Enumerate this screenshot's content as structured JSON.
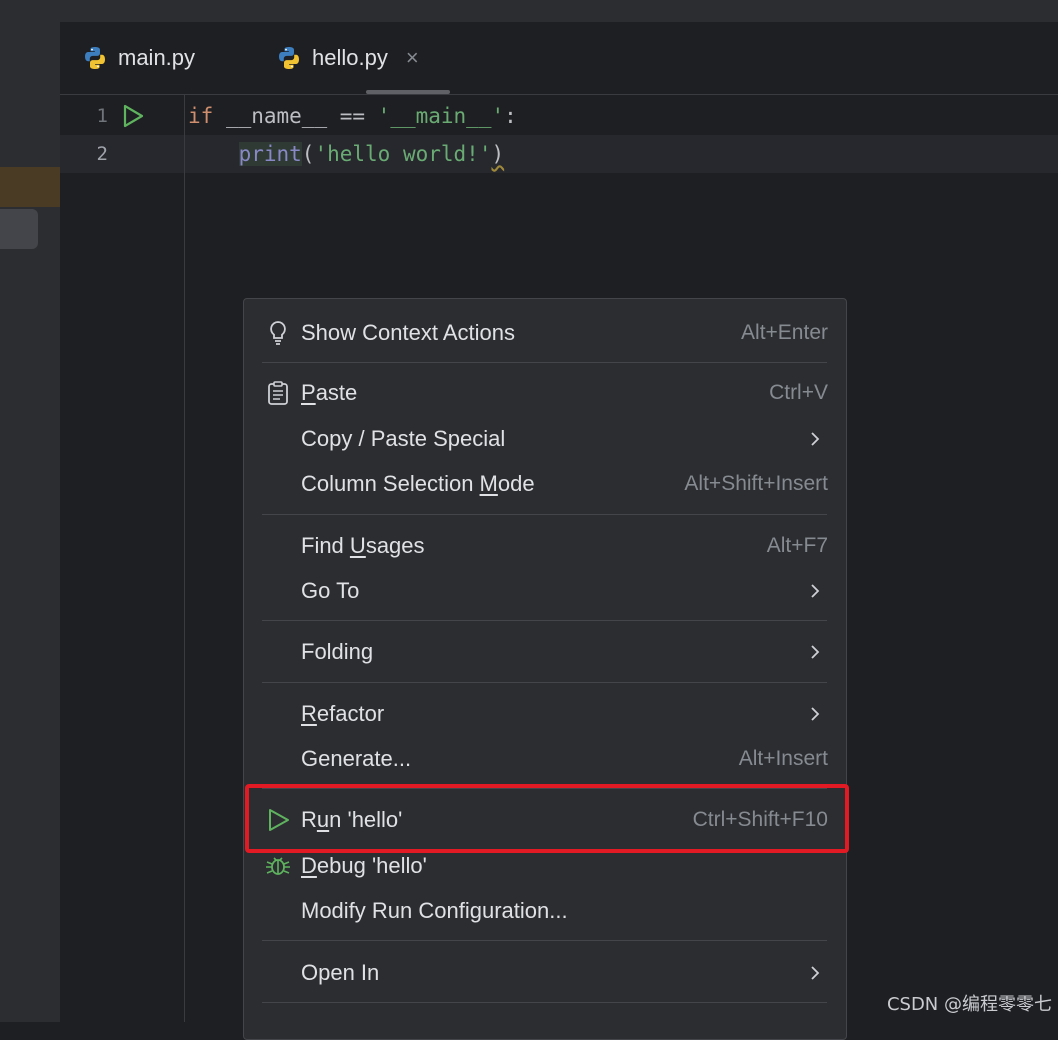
{
  "tabs": [
    {
      "label": "main.py",
      "icon": "python-icon",
      "active": false
    },
    {
      "label": "hello.py",
      "icon": "python-icon",
      "active": true,
      "close": "×"
    }
  ],
  "editor": {
    "lines": [
      {
        "number": "1",
        "tokens": [
          {
            "text": "if",
            "kind": "kw"
          },
          {
            "text": " __name__ == ",
            "kind": "plain"
          },
          {
            "text": "'__main__'",
            "kind": "str"
          },
          {
            "text": ":",
            "kind": "plain"
          }
        ]
      },
      {
        "number": "2",
        "tokens": [
          {
            "text": "    ",
            "kind": "plain"
          },
          {
            "text": "print",
            "kind": "fn"
          },
          {
            "text": "(",
            "kind": "plain"
          },
          {
            "text": "'hello world!'",
            "kind": "str"
          },
          {
            "text": ")",
            "kind": "plain"
          }
        ]
      }
    ]
  },
  "context_menu": {
    "items": [
      {
        "label": "Show Context Actions",
        "shortcut": "Alt+Enter",
        "icon": "lightbulb-icon"
      },
      {
        "label_pre": "",
        "label_u": "P",
        "label_post": "aste",
        "shortcut": "Ctrl+V",
        "icon": "clipboard-icon"
      },
      {
        "label": "Copy / Paste Special",
        "submenu": true
      },
      {
        "label_pre": "Column Selection ",
        "label_u": "M",
        "label_post": "ode",
        "shortcut": "Alt+Shift+Insert"
      },
      {
        "label_pre": "Find ",
        "label_u": "U",
        "label_post": "sages",
        "shortcut": "Alt+F7"
      },
      {
        "label": "Go To",
        "submenu": true
      },
      {
        "label": "Folding",
        "submenu": true
      },
      {
        "label_pre": "",
        "label_u": "R",
        "label_post": "efactor",
        "submenu": true
      },
      {
        "label": "Generate...",
        "shortcut": "Alt+Insert"
      },
      {
        "label_pre": "R",
        "label_u": "u",
        "label_post": "n 'hello'",
        "shortcut": "Ctrl+Shift+F10",
        "icon": "run-icon"
      },
      {
        "label_pre": "",
        "label_u": "D",
        "label_post": "ebug 'hello'",
        "icon": "debug-icon"
      },
      {
        "label": "Modify Run Configuration..."
      },
      {
        "label": "Open In",
        "submenu": true
      }
    ]
  },
  "colors": {
    "highlight_box": "#e21a24",
    "run_green": "#5fb35f"
  },
  "watermark": "CSDN @编程零零七"
}
